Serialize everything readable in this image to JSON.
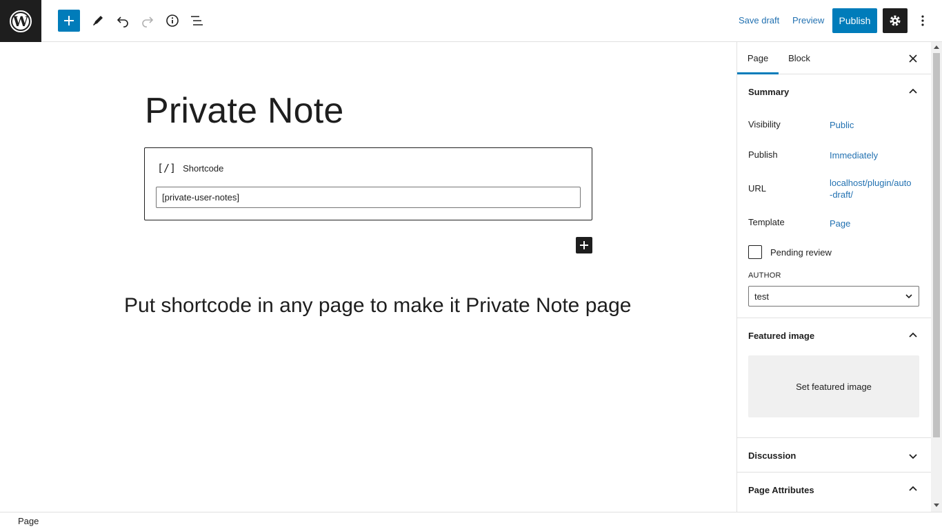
{
  "toolbar": {
    "save_draft": "Save draft",
    "preview": "Preview",
    "publish": "Publish"
  },
  "editor": {
    "title": "Private Note",
    "shortcode_block": {
      "icon": "[/]",
      "label": "Shortcode",
      "value": "[private-user-notes]"
    },
    "paragraph": "Put shortcode in any page to make it Private Note page"
  },
  "sidebar": {
    "tabs": [
      "Page",
      "Block"
    ],
    "summary": {
      "title": "Summary",
      "visibility_label": "Visibility",
      "visibility_value": "Public",
      "publish_label": "Publish",
      "publish_value": "Immediately",
      "url_label": "URL",
      "url_value_line1": "localhost/plugin/auto",
      "url_value_line2": "-draft/",
      "template_label": "Template",
      "template_value": "Page",
      "pending_review": "Pending review",
      "author_label": "AUTHOR",
      "author_value": "test"
    },
    "featured_image": {
      "title": "Featured image",
      "button": "Set featured image"
    },
    "discussion": "Discussion",
    "page_attributes": "Page Attributes"
  },
  "footer": {
    "breadcrumb": "Page"
  },
  "colors": {
    "accent": "#007cba",
    "link": "#2271b1",
    "dark": "#1e1e1e"
  }
}
